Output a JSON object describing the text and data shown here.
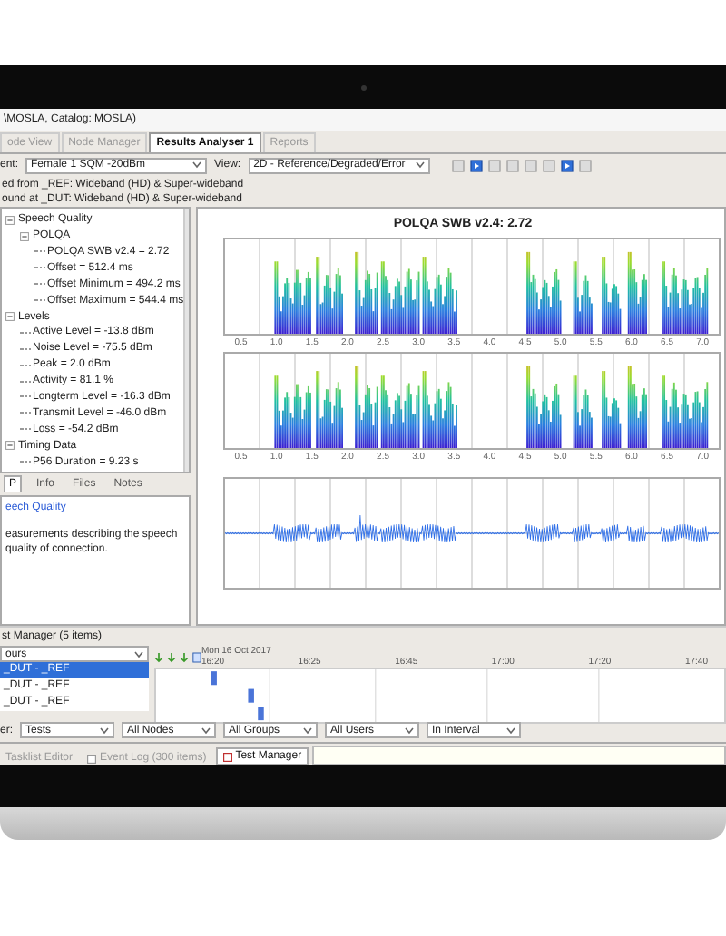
{
  "window": {
    "title": "\\MOSLA, Catalog: MOSLA)"
  },
  "tabs": [
    {
      "label": "ode View",
      "selected": false
    },
    {
      "label": "Node Manager",
      "selected": false
    },
    {
      "label": "Results Analyser 1",
      "selected": true
    },
    {
      "label": "Reports",
      "selected": false
    }
  ],
  "toolbar": {
    "test_label": "ent:",
    "test_value": "Female 1 SQM -20dBm",
    "view_label": "View:",
    "view_value": "2D - Reference/Degraded/Error"
  },
  "info_lines": [
    "ed from _REF: Wideband (HD) & Super-wideband",
    "ound at _DUT: Wideband (HD) & Super-wideband"
  ],
  "tree": [
    {
      "label": "Speech Quality",
      "expanded": true,
      "children": [
        {
          "label": "POLQA",
          "expanded": true,
          "children": [
            {
              "label": "POLQA SWB v2.4 = 2.72"
            },
            {
              "label": "Offset = 512.4 ms"
            },
            {
              "label": "Offset Minimum = 494.2 ms"
            },
            {
              "label": "Offset Maximum = 544.4 ms"
            }
          ]
        }
      ]
    },
    {
      "label": "Levels",
      "expanded": true,
      "children": [
        {
          "label": "Active Level = -13.8 dBm"
        },
        {
          "label": "Noise Level = -75.5 dBm"
        },
        {
          "label": "Peak = 2.0 dBm"
        },
        {
          "label": "Activity = 81.1 %"
        },
        {
          "label": "Longterm Level = -16.3 dBm"
        },
        {
          "label": "Transmit Level = -46.0 dBm"
        },
        {
          "label": "Loss = -54.2 dBm"
        }
      ]
    },
    {
      "label": "Timing Data",
      "expanded": true,
      "children": [
        {
          "label": "P56 Duration = 9.23 s"
        }
      ]
    }
  ],
  "detail_tabs": [
    {
      "label": "P",
      "selected": true
    },
    {
      "label": "Info",
      "selected": false
    },
    {
      "label": "Files",
      "selected": false
    },
    {
      "label": "Notes",
      "selected": false
    }
  ],
  "detail": {
    "link": "eech Quality",
    "description": "easurements describing the speech quality of connection."
  },
  "chart_panel": {
    "title": "POLQA SWB v2.4: 2.72",
    "plots": [
      {
        "kind": "spectrogram",
        "x_ticks": [
          "0.5",
          "1.0",
          "1.5",
          "2.0",
          "2.5",
          "3.0",
          "3.5",
          "4.0",
          "4.5",
          "5.0",
          "5.5",
          "6.0",
          "6.5",
          "7.0"
        ]
      },
      {
        "kind": "spectrogram",
        "x_ticks": [
          "0.5",
          "1.0",
          "1.5",
          "2.0",
          "2.5",
          "3.0",
          "3.5",
          "4.0",
          "4.5",
          "5.0",
          "5.5",
          "6.0",
          "6.5",
          "7.0"
        ]
      },
      {
        "kind": "waveform"
      }
    ]
  },
  "test_manager": {
    "title": "st Manager (5 items)",
    "group_by": "ours",
    "date": "Mon 16 Oct 2017",
    "times": [
      "16:20",
      "16:25",
      "16:45",
      "17:00",
      "17:20",
      "17:40"
    ],
    "rows": [
      {
        "label": "_DUT - _REF",
        "selected": true
      },
      {
        "label": "_DUT - _REF",
        "selected": false
      },
      {
        "label": "_DUT - _REF",
        "selected": false
      }
    ]
  },
  "filters": {
    "label": "er:",
    "values": [
      "Tests",
      "All Nodes",
      "All Groups",
      "All Users",
      "In Interval"
    ]
  },
  "bottom_tabs": [
    {
      "label": "Tasklist Editor",
      "selected": false
    },
    {
      "label": "Event Log (300 items)",
      "selected": false
    },
    {
      "label": "Test Manager",
      "selected": true
    }
  ]
}
